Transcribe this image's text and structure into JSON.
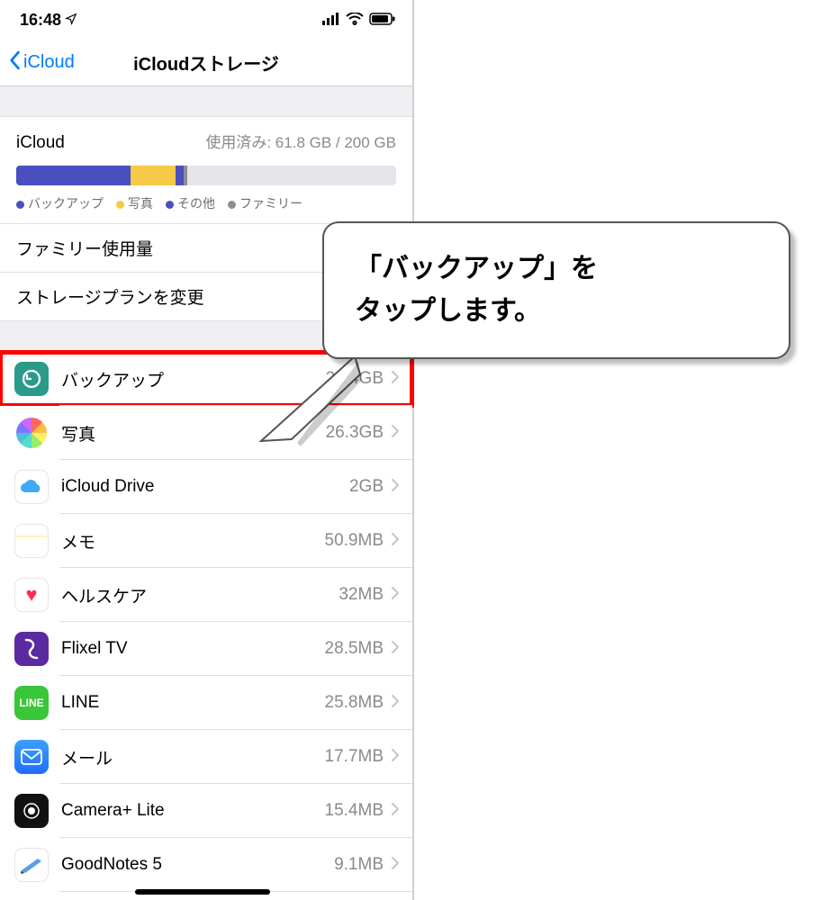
{
  "status": {
    "time": "16:48",
    "location_arrow": "↗"
  },
  "nav": {
    "back_label": "iCloud",
    "title": "iCloudストレージ"
  },
  "storage": {
    "title": "iCloud",
    "used_label": "使用済み: 61.8 GB / 200 GB",
    "segments": [
      {
        "label": "バックアップ",
        "color": "#4a4fbf",
        "pct": 30
      },
      {
        "label": "写真",
        "color": "#f7c948",
        "pct": 12
      },
      {
        "label": "その他",
        "color": "#4a4fbf",
        "pct": 2
      },
      {
        "label": "ファミリー",
        "color": "#8e8e93",
        "pct": 1
      }
    ],
    "legend": [
      {
        "label": "バックアップ",
        "color": "#4a4fbf"
      },
      {
        "label": "写真",
        "color": "#f7c948"
      },
      {
        "label": "その他",
        "color": "#4a4fbf"
      },
      {
        "label": "ファミリー",
        "color": "#8e8e93"
      }
    ]
  },
  "rows_group1": [
    {
      "label": "ファミリー使用量"
    },
    {
      "label": "ストレージプランを変更"
    }
  ],
  "apps": [
    {
      "icon": "backup-icon",
      "icon_class": "ic-backup",
      "label": "バックアップ",
      "value": "28.4GB",
      "highlight": true
    },
    {
      "icon": "photos-icon",
      "icon_class": "ic-photos",
      "label": "写真",
      "value": "26.3GB"
    },
    {
      "icon": "icloud-drive-icon",
      "icon_class": "ic-icloud",
      "label": "iCloud Drive",
      "value": "2GB"
    },
    {
      "icon": "notes-icon",
      "icon_class": "ic-notes",
      "label": "メモ",
      "value": "50.9MB"
    },
    {
      "icon": "health-icon",
      "icon_class": "ic-health",
      "label": "ヘルスケア",
      "value": "32MB"
    },
    {
      "icon": "flixel-icon",
      "icon_class": "ic-flixel",
      "label": "Flixel TV",
      "value": "28.5MB"
    },
    {
      "icon": "line-icon",
      "icon_class": "ic-line",
      "label": "LINE",
      "value": "25.8MB"
    },
    {
      "icon": "mail-icon",
      "icon_class": "ic-mail",
      "label": "メール",
      "value": "17.7MB"
    },
    {
      "icon": "cameraplus-icon",
      "icon_class": "ic-camplus",
      "label": "Camera+ Lite",
      "value": "15.4MB"
    },
    {
      "icon": "goodnotes-icon",
      "icon_class": "ic-goodnotes",
      "label": "GoodNotes 5",
      "value": "9.1MB"
    }
  ],
  "callout": {
    "line1": "「バックアップ」を",
    "line2": "タップします。"
  }
}
